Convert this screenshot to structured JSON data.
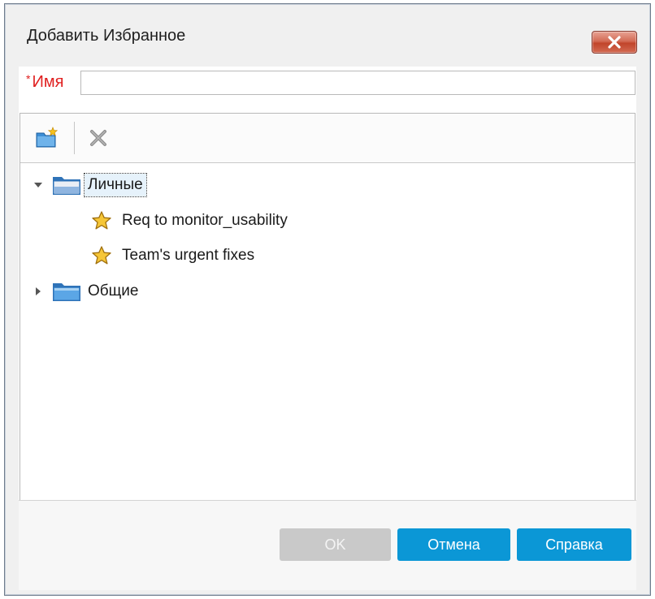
{
  "dialog": {
    "title": "Добавить Избранное",
    "close_icon": "close-icon"
  },
  "name_field": {
    "required_mark": "*",
    "label": "Имя",
    "value": "",
    "placeholder": ""
  },
  "toolbar": {
    "new_folder_icon": "new-folder-icon",
    "delete_icon": "delete-icon"
  },
  "tree": {
    "nodes": [
      {
        "label": "Личные",
        "expanded": true,
        "selected": true,
        "icon": "folder-icon",
        "children": [
          {
            "label": "Req to monitor_usability",
            "icon": "star-icon"
          },
          {
            "label": "Team's urgent fixes",
            "icon": "star-icon"
          }
        ]
      },
      {
        "label": "Общие",
        "expanded": false,
        "selected": false,
        "icon": "folder-icon"
      }
    ]
  },
  "buttons": {
    "ok": "OK",
    "cancel": "Отмена",
    "help": "Справка"
  },
  "colors": {
    "primary_button": "#0b97d6",
    "disabled_button": "#c9c9c9",
    "required_label": "#e02020",
    "selection": "#e6f2fb"
  }
}
